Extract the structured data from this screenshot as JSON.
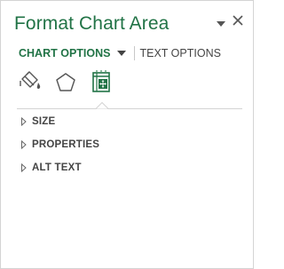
{
  "pane": {
    "title": "Format Chart Area",
    "menu_icon": "chevron-down-icon",
    "close_icon": "close-icon",
    "close_symbol": "✕"
  },
  "tabs": {
    "chart_options": "CHART OPTIONS",
    "text_options": "TEXT OPTIONS"
  },
  "icons": [
    {
      "name": "fill-line-icon"
    },
    {
      "name": "effects-icon"
    },
    {
      "name": "size-properties-icon",
      "selected": true
    }
  ],
  "sections": [
    {
      "label": "SIZE"
    },
    {
      "label": "PROPERTIES"
    },
    {
      "label": "ALT TEXT"
    }
  ],
  "colors": {
    "accent": "#217346",
    "text": "#444444"
  }
}
